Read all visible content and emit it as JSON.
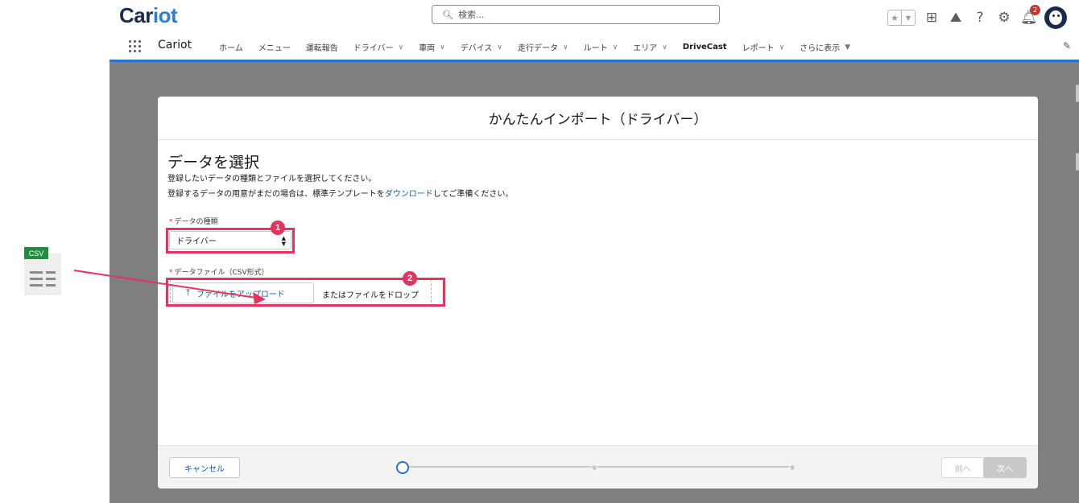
{
  "header": {
    "logo_main": "Car",
    "logo_accent": "iot",
    "search_placeholder": "検索...",
    "notification_count": "2"
  },
  "nav": {
    "app_name": "Cariot",
    "items": [
      {
        "label": "ホーム",
        "dropdown": false
      },
      {
        "label": "メニュー",
        "dropdown": false
      },
      {
        "label": "運転報告",
        "dropdown": false
      },
      {
        "label": "ドライバー",
        "dropdown": true
      },
      {
        "label": "車両",
        "dropdown": true
      },
      {
        "label": "デバイス",
        "dropdown": true
      },
      {
        "label": "走行データ",
        "dropdown": true
      },
      {
        "label": "ルート",
        "dropdown": true
      },
      {
        "label": "エリア",
        "dropdown": true
      },
      {
        "label": "DriveCast",
        "dropdown": false
      },
      {
        "label": "レポート",
        "dropdown": true
      },
      {
        "label": "さらに表示",
        "dropdown": true
      }
    ]
  },
  "modal": {
    "title": "かんたんインポート（ドライバー）",
    "section_title": "データを選択",
    "desc_line1": "登録したいデータの種類とファイルを選択してください。",
    "desc_line2_pre": "登録するデータの用意がまだの場合は、標準テンプレートを",
    "desc_line2_link": "ダウンロード",
    "desc_line2_post": "してご準備ください。",
    "data_type_label": "データの種類",
    "data_type_value": "ドライバー",
    "data_file_label": "データファイル（CSV形式）",
    "upload_button": "ファイルをアップロード",
    "drop_text": "またはファイルをドロップ",
    "cancel_button": "キャンセル",
    "prev_button": "前へ",
    "next_button": "次へ",
    "current_step": 1,
    "total_steps": 3
  },
  "annotations": {
    "step1": "1",
    "step2": "2",
    "highlight_color": "#e2345c"
  },
  "csv_icon": {
    "label": "CSV",
    "color": "#1e8e3e"
  },
  "colors": {
    "brand_dark": "#1a2c4e",
    "brand_accent": "#2c7fd8",
    "nav_underline": "#2a6fd1",
    "link": "#0b5cab"
  }
}
